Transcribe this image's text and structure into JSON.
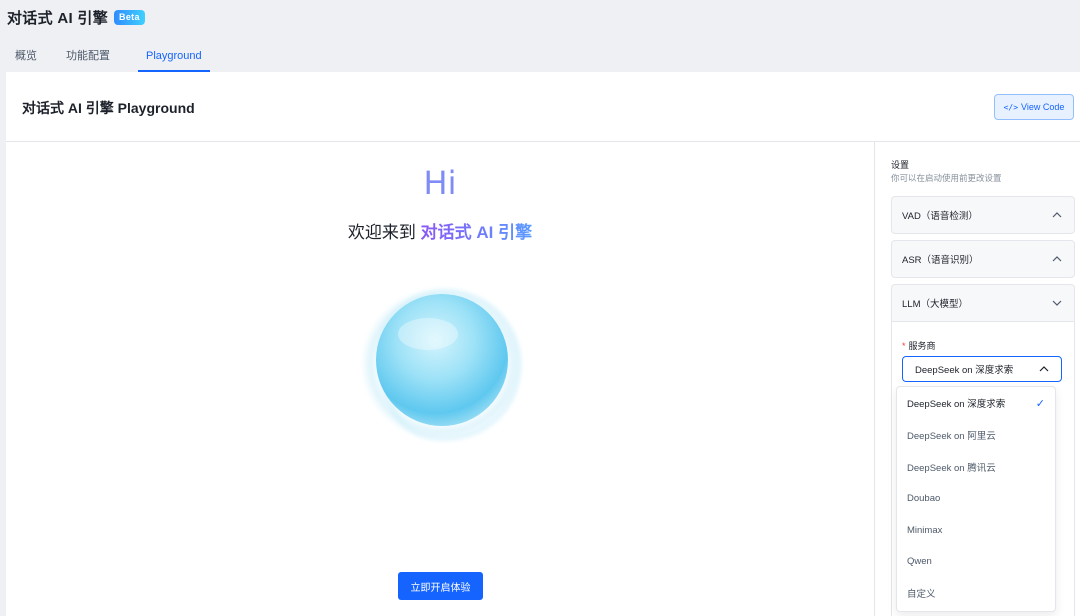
{
  "app": {
    "title": "对话式 AI 引擎",
    "badge": "Beta"
  },
  "tabs": [
    {
      "label": "概览"
    },
    {
      "label": "功能配置"
    },
    {
      "label": "Playground"
    }
  ],
  "header": {
    "title": "对话式 AI 引擎 Playground",
    "view_code_icon": "</>",
    "view_code_label": "View Code"
  },
  "hero": {
    "greeting": "Hi",
    "welcome_prefix": "欢迎来到 ",
    "welcome_highlight": "对话式 AI 引擎",
    "start_button": "立即开启体验"
  },
  "settings": {
    "title": "设置",
    "subtitle": "你可以在启动使用前更改设置",
    "sections": [
      {
        "label": "VAD（语音检测）"
      },
      {
        "label": "ASR（语音识别）"
      },
      {
        "label": "LLM（大模型）"
      }
    ],
    "provider": {
      "required_mark": "*",
      "label": "服务商",
      "selected": "DeepSeek on 深度求索",
      "options": [
        {
          "label": "DeepSeek on 深度求索",
          "checked": true
        },
        {
          "label": "DeepSeek on 阿里云"
        },
        {
          "label": "DeepSeek on 腾讯云"
        },
        {
          "label": "Doubao"
        },
        {
          "label": "Minimax"
        },
        {
          "label": "Qwen"
        },
        {
          "label": "自定义"
        }
      ]
    }
  },
  "colors": {
    "primary": "#1664ff",
    "border": "#e5e6eb",
    "title_text": "#1d2129",
    "hi_color": "#7f8cf5"
  }
}
